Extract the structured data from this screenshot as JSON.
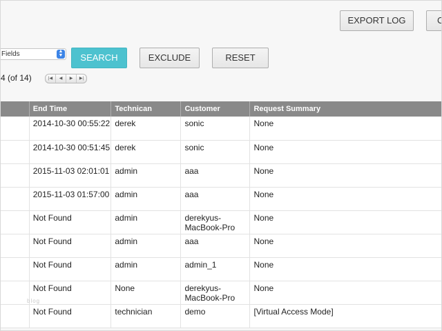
{
  "toolbar": {
    "export_label": "EXPORT LOG",
    "next_button_fragment": "C"
  },
  "filters": {
    "field_select": "Fields",
    "search_label": "SEARCH",
    "exclude_label": "EXCLUDE",
    "reset_label": "RESET"
  },
  "pagination": {
    "count_text": "4 (of 14)",
    "first_icon": "double-left-icon",
    "prev_icon": "left-icon",
    "next_icon": "right-icon",
    "last_icon": "double-right-icon"
  },
  "table": {
    "headers": [
      "",
      "End Time",
      "Technican",
      "Customer",
      "Request Summary"
    ],
    "rows": [
      {
        "end_time": "2014-10-30 00:55:22",
        "technician": "derek",
        "customer": "sonic",
        "summary": "None"
      },
      {
        "end_time": "2014-10-30 00:51:45",
        "technician": "derek",
        "customer": "sonic",
        "summary": "None"
      },
      {
        "end_time": "2015-11-03 02:01:01",
        "technician": "admin",
        "customer": "aaa",
        "summary": "None"
      },
      {
        "end_time": "2015-11-03 01:57:00",
        "technician": "admin",
        "customer": "aaa",
        "summary": "None"
      },
      {
        "end_time": "Not Found",
        "technician": "admin",
        "customer": "derekyus-MacBook-Pro",
        "summary": "None"
      },
      {
        "end_time": "Not Found",
        "technician": "admin",
        "customer": "aaa",
        "summary": "None"
      },
      {
        "end_time": "Not Found",
        "technician": "admin",
        "customer": "admin_1",
        "summary": "None"
      },
      {
        "end_time": "Not Found",
        "technician": "None",
        "customer": "derekyus-MacBook-Pro",
        "summary": "None"
      },
      {
        "end_time": "Not Found",
        "technician": "technician",
        "customer": "demo",
        "summary": "[Virtual Access Mode]"
      }
    ]
  },
  "watermark": "blog",
  "colors": {
    "accent": "#4dc2cf",
    "header_bg": "#898989",
    "select_arrow": "#3c84e6"
  }
}
